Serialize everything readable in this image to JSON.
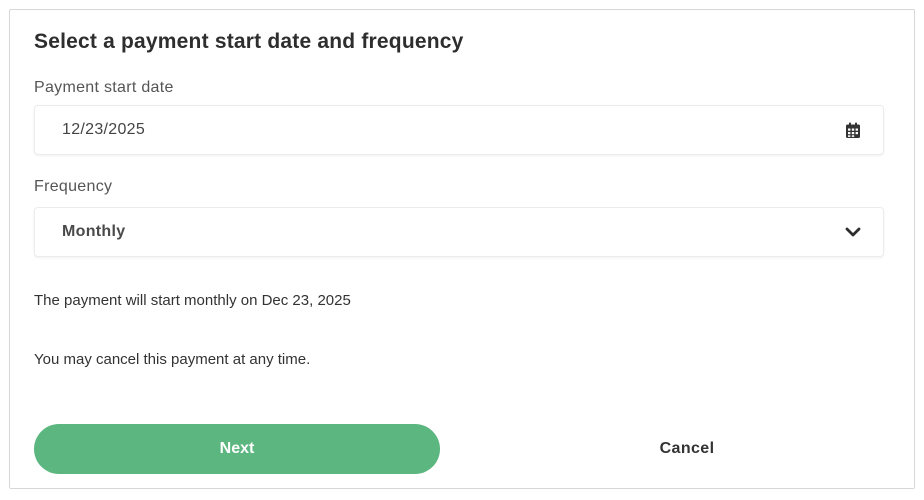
{
  "dialog": {
    "title": "Select a payment start date and frequency"
  },
  "start_date": {
    "label": "Payment start date",
    "value": "12/23/2025",
    "icon": "calendar-icon"
  },
  "frequency": {
    "label": "Frequency",
    "value": "Monthly",
    "icon": "chevron-down-icon"
  },
  "summary": {
    "start_text": "The payment will start monthly on Dec 23, 2025",
    "cancel_text": "You may cancel this payment at any time."
  },
  "actions": {
    "next_label": "Next",
    "cancel_label": "Cancel"
  },
  "colors": {
    "primary": "#5cb67f",
    "border": "#d7d7d7",
    "text": "#333333"
  }
}
